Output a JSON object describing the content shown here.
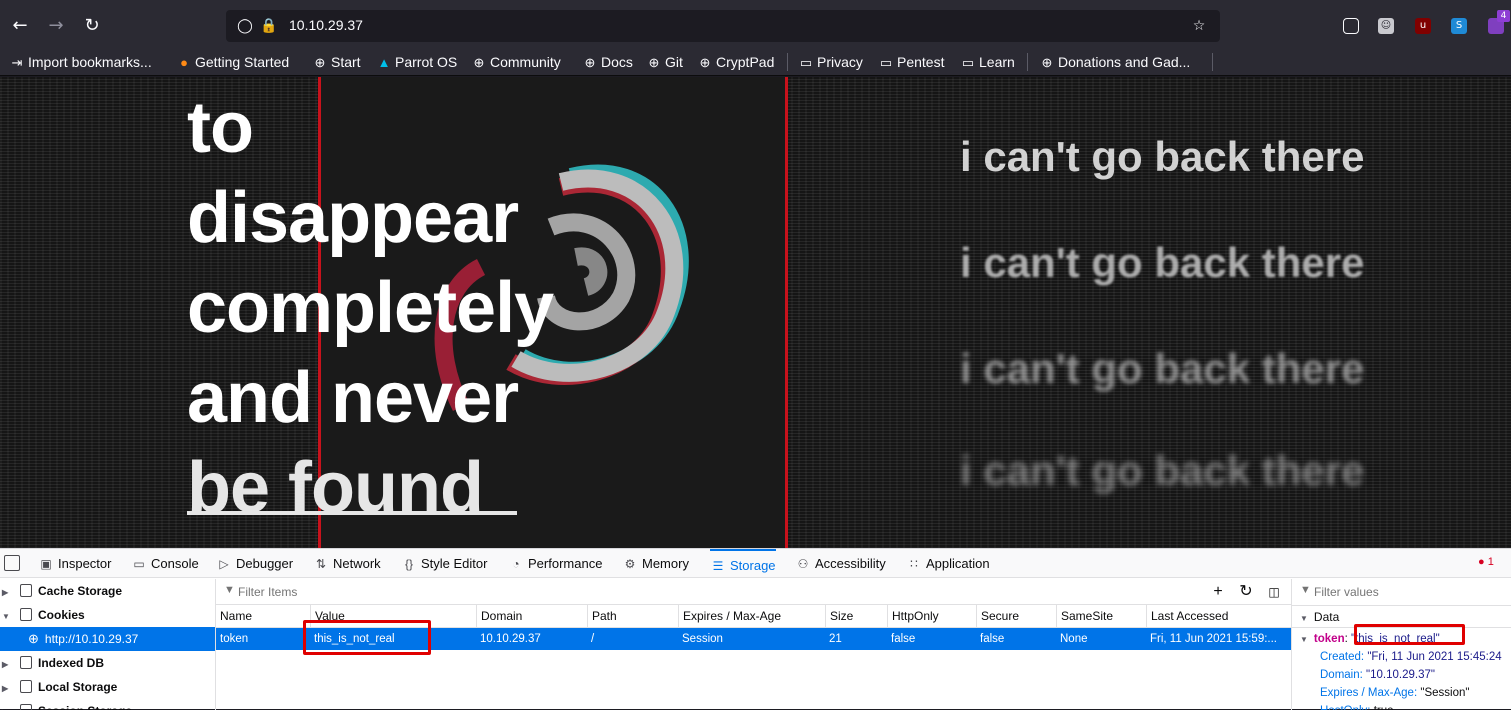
{
  "browser": {
    "url": "10.10.29.37",
    "badge_count": "4",
    "bookmarks": [
      {
        "label": "Import bookmarks...",
        "icon": "import-icon"
      },
      {
        "label": "Getting Started",
        "icon": "firefox-icon"
      },
      {
        "label": "Start",
        "icon": "globe-icon"
      },
      {
        "label": "Parrot OS",
        "icon": "parrot-icon"
      },
      {
        "label": "Community",
        "icon": "globe-icon"
      },
      {
        "label": "Docs",
        "icon": "globe-icon"
      },
      {
        "label": "Git",
        "icon": "globe-icon"
      },
      {
        "label": "CryptPad",
        "icon": "globe-icon"
      },
      {
        "label": "Privacy",
        "icon": "folder-icon"
      },
      {
        "label": "Pentest",
        "icon": "folder-icon"
      },
      {
        "label": "Learn",
        "icon": "folder-icon"
      },
      {
        "label": "Donations and Gad...",
        "icon": "globe-icon"
      }
    ]
  },
  "page": {
    "headline": [
      "to",
      "disappear",
      "completely",
      "and never",
      "be found"
    ],
    "echo_lines": [
      "i can't go back there",
      "i can't go back there",
      "i can't go back there",
      "i can't go back there"
    ]
  },
  "devtools": {
    "tabs": [
      {
        "label": "Inspector",
        "icon": "inspector-icon"
      },
      {
        "label": "Console",
        "icon": "console-icon"
      },
      {
        "label": "Debugger",
        "icon": "debugger-icon"
      },
      {
        "label": "Network",
        "icon": "network-icon"
      },
      {
        "label": "Style Editor",
        "icon": "style-editor-icon"
      },
      {
        "label": "Performance",
        "icon": "performance-icon"
      },
      {
        "label": "Memory",
        "icon": "memory-icon"
      },
      {
        "label": "Storage",
        "icon": "storage-icon",
        "active": true
      },
      {
        "label": "Accessibility",
        "icon": "accessibility-icon"
      },
      {
        "label": "Application",
        "icon": "application-icon"
      }
    ],
    "error_count": "1",
    "tree": [
      {
        "label": "Cache Storage",
        "expanded": false
      },
      {
        "label": "Cookies",
        "expanded": true
      },
      {
        "label": "http://10.10.29.37",
        "selected": true
      },
      {
        "label": "Indexed DB",
        "expanded": false
      },
      {
        "label": "Local Storage",
        "expanded": false
      },
      {
        "label": "Session Storage",
        "expanded": false
      }
    ],
    "filter_items_placeholder": "Filter Items",
    "filter_values_placeholder": "Filter values",
    "columns": [
      "Name",
      "Value",
      "Domain",
      "Path",
      "Expires / Max-Age",
      "Size",
      "HttpOnly",
      "Secure",
      "SameSite",
      "Last Accessed"
    ],
    "cookie": {
      "name": "token",
      "value": "this_is_not_real",
      "domain": "10.10.29.37",
      "path": "/",
      "expires": "Session",
      "size": "21",
      "httponly": "false",
      "secure": "false",
      "samesite": "None",
      "last_accessed": "Fri, 11 Jun 2021 15:59:..."
    },
    "sidebar": {
      "section": "Data",
      "token_key": "token",
      "token_value": "\"this_is_not_real\"",
      "details": [
        {
          "key": "Created:",
          "value": "\"Fri, 11 Jun 2021 15:45:24"
        },
        {
          "key": "Domain:",
          "value": "\"10.10.29.37\""
        },
        {
          "key": "Expires / Max-Age:",
          "value": "\"Session\""
        },
        {
          "key": "HostOnly:",
          "value": "true"
        }
      ]
    }
  },
  "colors": {
    "accent": "#0074e8",
    "highlight_box": "#e00000",
    "chrome_bg": "#2b2a33"
  }
}
